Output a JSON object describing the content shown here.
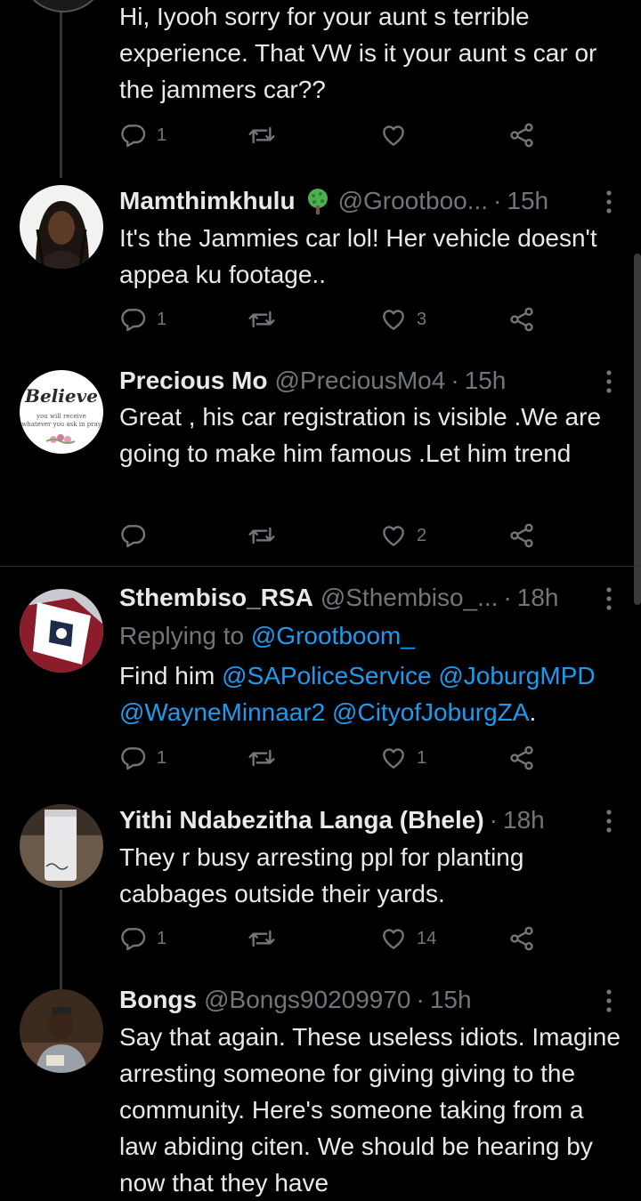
{
  "tweets": [
    {
      "text": "Hi, Iyooh sorry for your aunt s terrible experience. That VW is it your aunt s car or the jammers car??",
      "replies": "1",
      "retweets": "",
      "likes": ""
    },
    {
      "name": "Mamthimkhulu",
      "handle": "@Grootboo...",
      "dot": "·",
      "time": "15h",
      "text": "It's the Jammies car lol! Her vehicle doesn't appea ku footage..",
      "replies": "1",
      "retweets": "",
      "likes": "3"
    },
    {
      "name": "Precious Mo",
      "handle": "@PreciousMo4",
      "dot": "·",
      "time": "15h",
      "avatar_text": {
        "line1": "Believe",
        "line2": "you will receive",
        "line3": "whatever you ask in pray"
      },
      "text": "Great , his car registration is visible .We are going to make him famous .Let him trend",
      "replies": "",
      "retweets": "",
      "likes": "2"
    },
    {
      "name": "Sthembiso_RSA",
      "handle": "@Sthembiso_...",
      "dot": "·",
      "time": "18h",
      "replying_label": "Replying to",
      "replying_handle": "@Grootboom_",
      "text_prefix": "Find him",
      "mentions": [
        "@SAPoliceService",
        "@JoburgMPD",
        "@WayneMinnaar2",
        "@CityofJoburgZA"
      ],
      "text_suffix": ".",
      "replies": "1",
      "retweets": "",
      "likes": "1"
    },
    {
      "name": "Yithi Ndabezitha Langa (Bhele)",
      "dot": "·",
      "time": "18h",
      "text": "They r busy arresting ppl for planting cabbages outside their yards.",
      "replies": "1",
      "retweets": "",
      "likes": "14"
    },
    {
      "name": "Bongs",
      "handle": "@Bongs90209970",
      "dot": "·",
      "time": "15h",
      "text": "Say that again. These useless idiots. Imagine arresting someone for giving giving to the community. Here's someone taking from a law abiding citen. We should be hearing by now that they have"
    }
  ],
  "icons": {
    "reply": "reply-icon",
    "retweet": "retweet-icon",
    "like": "heart-icon",
    "share": "share-icon",
    "more": "more-icon",
    "tree": "tree-emoji"
  },
  "colors": {
    "background": "#000000",
    "text": "#e7e9ea",
    "secondary": "#71767b",
    "link": "#1d9bf0",
    "divider": "#2f3336"
  }
}
